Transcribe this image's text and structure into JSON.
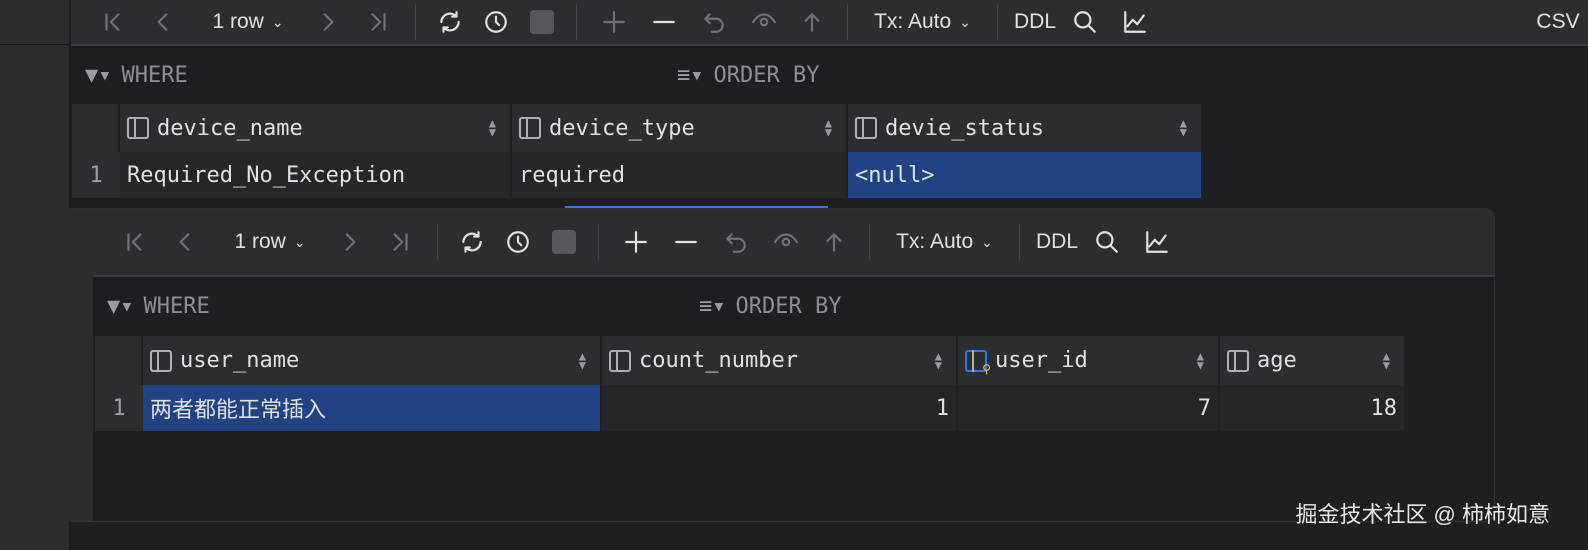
{
  "panel1": {
    "toolbar": {
      "rows": "1 row",
      "tx": "Tx: Auto",
      "ddl": "DDL",
      "csv": "CSV"
    },
    "filter": {
      "where": "WHERE",
      "order_by": "ORDER BY"
    },
    "columns": [
      "device_name",
      "device_type",
      "devie_status"
    ],
    "rows": [
      {
        "num": "1",
        "cells": [
          "Required_No_Exception",
          "required",
          "<null>"
        ]
      }
    ]
  },
  "panel2": {
    "toolbar": {
      "rows": "1 row",
      "tx": "Tx: Auto",
      "ddl": "DDL"
    },
    "filter": {
      "where": "WHERE",
      "order_by": "ORDER BY"
    },
    "columns": [
      "user_name",
      "count_number",
      "user_id",
      "age"
    ],
    "rows": [
      {
        "num": "1",
        "cells": [
          "两者都能正常插入",
          "1",
          "7",
          "18"
        ]
      }
    ]
  },
  "watermark": "掘金技术社区 @ 柿柿如意",
  "colors": {
    "selection": "#214283",
    "accent": "#3574f0",
    "key": "#f2c55c"
  }
}
